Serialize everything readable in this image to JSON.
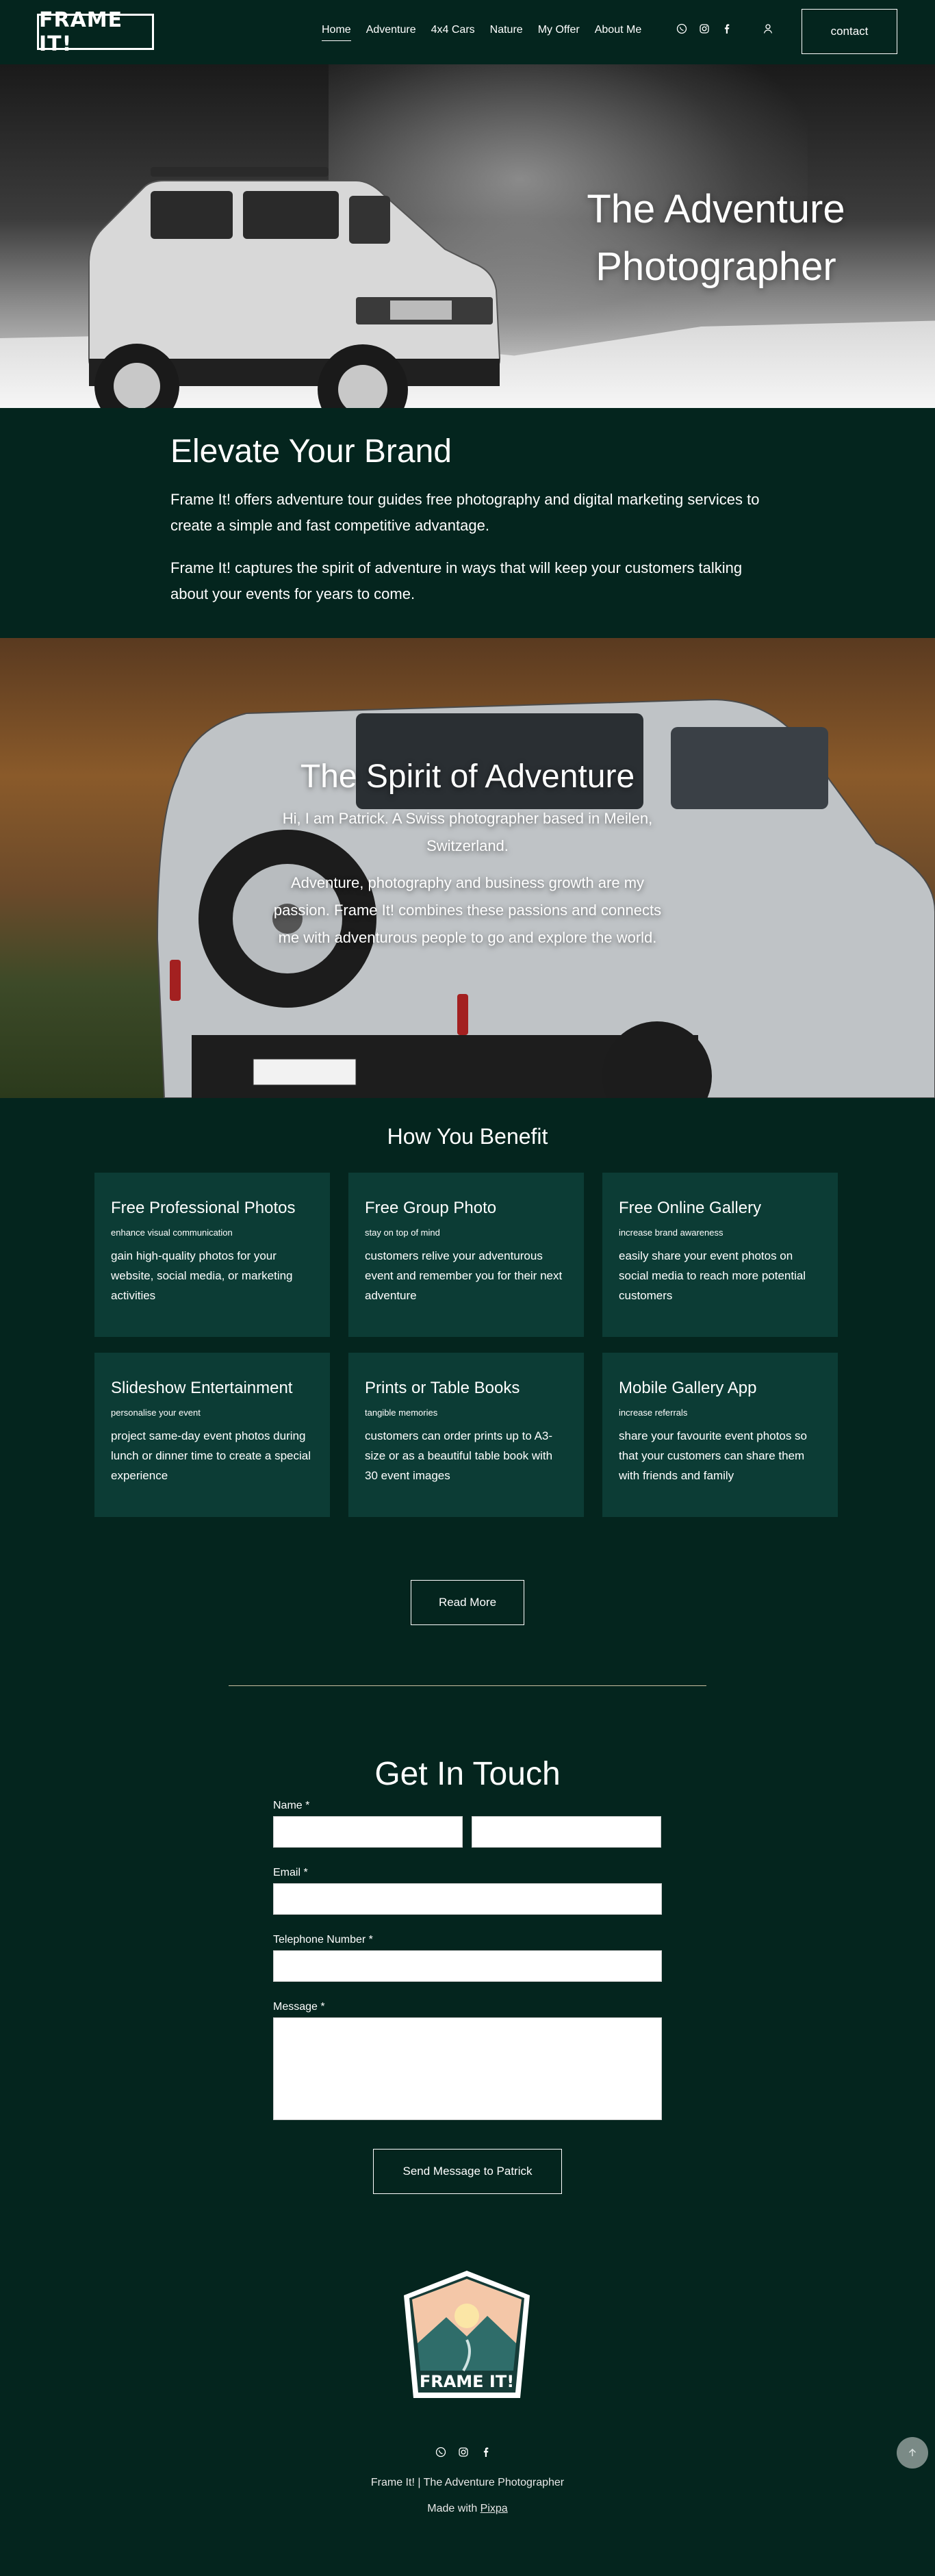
{
  "header": {
    "logo_text": "FRAME IT!",
    "nav": [
      "Home",
      "Adventure",
      "4x4 Cars",
      "Nature",
      "My Offer",
      "About Me"
    ],
    "contact_label": "contact"
  },
  "hero": {
    "title": "The Adventure Photographer"
  },
  "elevate": {
    "title": "Elevate Your Brand",
    "p1": "Frame It! offers adventure tour guides free photography and digital marketing services to create a simple and fast competitive advantage.",
    "p2": "Frame It! captures the spirit of adventure in ways that will keep your customers talking about your events for years to come."
  },
  "spirit": {
    "title": "The Spirit of Adventure",
    "p1": "Hi, I am Patrick. A Swiss photographer based in Meilen, Switzerland.",
    "p2": "Adventure, photography and business growth are my passion. Frame It! combines these passions and connects me with adventurous people to go and explore the world."
  },
  "benefit": {
    "title": "How You Benefit",
    "cards": [
      {
        "title": "Free Professional Photos",
        "sub": "enhance visual communication",
        "desc": "gain high-quality photos for your website, social media, or marketing activities"
      },
      {
        "title": "Free Group Photo",
        "sub": "stay on top of mind",
        "desc": "customers relive your adventurous event and remember you for their next adventure"
      },
      {
        "title": "Free Online Gallery",
        "sub": "increase brand awareness",
        "desc": "easily share your event photos on social media to reach more potential customers"
      },
      {
        "title": "Slideshow Entertainment",
        "sub": "personalise your event",
        "desc": "project same-day event photos during lunch or dinner time to create a special experience"
      },
      {
        "title": "Prints or Table Books",
        "sub": "tangible memories",
        "desc": "customers can order prints up to A3-size or as a beautiful table book with 30 event images"
      },
      {
        "title": "Mobile Gallery App",
        "sub": "increase referrals",
        "desc": "share your favourite event photos so that your customers can share them with friends and family"
      }
    ],
    "read_more": "Read More"
  },
  "contact": {
    "title": "Get In Touch",
    "name_label": "Name *",
    "email_label": "Email *",
    "phone_label": "Telephone Number *",
    "message_label": "Message *",
    "send_label": "Send Message to Patrick"
  },
  "footer": {
    "badge_text": "FRAME IT!",
    "line1": "Frame It! | The Adventure Photographer",
    "made_with": "Made with ",
    "made_with_link": "Pixpa"
  },
  "colors": {
    "background": "#04251e",
    "card": "#0c3c35",
    "scroll_top": "#7a8a86"
  },
  "icons": [
    "whatsapp-icon",
    "instagram-icon",
    "facebook-icon",
    "user-icon",
    "arrow-up-icon"
  ]
}
